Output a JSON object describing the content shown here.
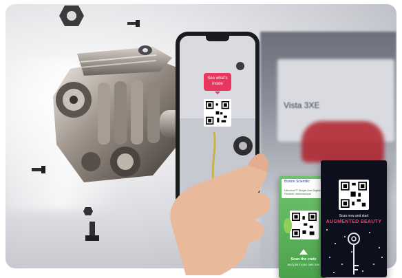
{
  "phone_bubble": "See what's inside",
  "card_green": {
    "brand": "Boston Scientific",
    "subtitle": "LithoVue™ Single-Use Digital Flexible Ureteroscope",
    "cta_title": "Scan the code",
    "cta_sub": "and plant your own tree"
  },
  "card_dark": {
    "line1": "Scan now and start",
    "line2": "AUGMENTED BEAUTY"
  },
  "showroom_sign": "Vista 3XE",
  "colors": {
    "accent_pink": "#e8365f",
    "card_green": "#4ba24c",
    "card_dark": "#0d0f1c"
  }
}
